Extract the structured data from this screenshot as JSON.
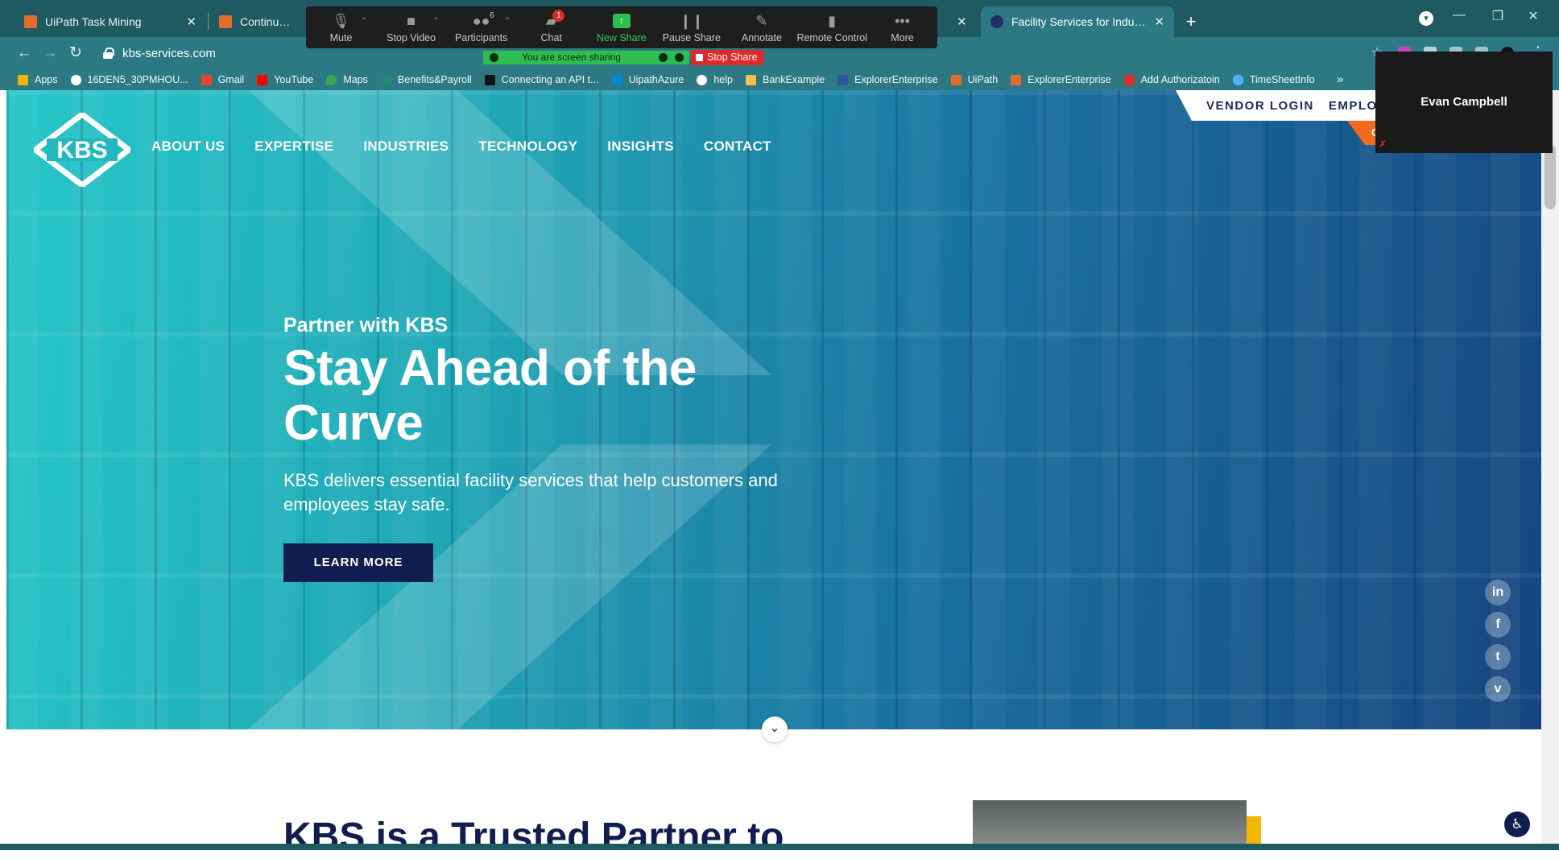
{
  "browser": {
    "tabs": [
      {
        "title": "UiPath Task Mining"
      },
      {
        "title": "Continue with Ui"
      },
      {
        "title": "Facility Services for Industry Lead"
      }
    ],
    "url": "kbs-services.com",
    "bookmarks": [
      {
        "label": "Apps",
        "icon": "apps-grid-icon",
        "color": "#f2b705"
      },
      {
        "label": "16DEN5_30PMHOU...",
        "icon": "globe-icon",
        "color": "#ffffff"
      },
      {
        "label": "Gmail",
        "icon": "gmail-icon",
        "color": "#ea4335"
      },
      {
        "label": "YouTube",
        "icon": "youtube-icon",
        "color": "#ff0000"
      },
      {
        "label": "Maps",
        "icon": "maps-pin-icon",
        "color": "#34a853"
      },
      {
        "label": "Benefits&Payroll",
        "icon": "payroll-icon",
        "color": "#1c8a6e"
      },
      {
        "label": "Connecting an API t...",
        "icon": "medium-icon",
        "color": "#111111"
      },
      {
        "label": "UipathAzure",
        "icon": "azure-icon",
        "color": "#0089d6"
      },
      {
        "label": "help",
        "icon": "github-icon",
        "color": "#ffffff"
      },
      {
        "label": "BankExample",
        "icon": "bank-icon",
        "color": "#f2c14e"
      },
      {
        "label": "ExplorerEnterprise",
        "icon": "word-icon",
        "color": "#2b579a"
      },
      {
        "label": "UiPath",
        "icon": "uipath-icon",
        "color": "#e26d2d"
      },
      {
        "label": "ExplorerEnterprise",
        "icon": "uipath-icon",
        "color": "#e26d2d"
      },
      {
        "label": "Add Authorizatoin",
        "icon": "puzzle-icon",
        "color": "#d93025"
      },
      {
        "label": "TimeSheetInfo",
        "icon": "cloud-icon",
        "color": "#4fb3f6"
      }
    ],
    "more_bookmarks": "»"
  },
  "zoom": {
    "buttons": [
      {
        "label": "Mute",
        "icon": "microphone-icon"
      },
      {
        "label": "Stop Video",
        "icon": "video-camera-icon"
      },
      {
        "label": "Participants",
        "icon": "participants-icon",
        "count": "6"
      },
      {
        "label": "Chat",
        "icon": "chat-bubble-icon",
        "badge": "1"
      },
      {
        "label": "New Share",
        "icon": "share-screen-icon"
      },
      {
        "label": "Pause Share",
        "icon": "pause-icon"
      },
      {
        "label": "Annotate",
        "icon": "pencil-icon"
      },
      {
        "label": "Remote Control",
        "icon": "mouse-icon"
      },
      {
        "label": "More",
        "icon": "ellipsis-icon"
      }
    ],
    "sharing_banner": "You are screen sharing",
    "stop_share": "Stop Share",
    "participant_name": "Evan Campbell"
  },
  "site": {
    "logo_text": "KBS",
    "utility_links": [
      "VENDOR LOGIN",
      "EMPLOYE"
    ],
    "orange_tab": "C",
    "nav": [
      "ABOUT US",
      "EXPERTISE",
      "INDUSTRIES",
      "TECHNOLOGY",
      "INSIGHTS",
      "CONTACT"
    ],
    "hero": {
      "kicker": "Partner with KBS",
      "headline": "Stay Ahead of the Curve",
      "subcopy": "KBS delivers essential facility services that help customers and employees stay safe.",
      "cta": "LEARN MORE"
    },
    "social": [
      {
        "name": "linkedin",
        "glyph": "in"
      },
      {
        "name": "facebook",
        "glyph": "f"
      },
      {
        "name": "twitter",
        "glyph": "t"
      },
      {
        "name": "vimeo",
        "glyph": "v"
      }
    ],
    "section_title": "KBS is a Trusted Partner to"
  },
  "colors": {
    "browser_tabstrip": "#1f5a61",
    "browser_toolbar": "#2d7983",
    "brand_navy": "#101d4f",
    "accent_orange": "#f26b21",
    "zoom_green": "#2dbe4f",
    "zoom_red": "#e02828"
  }
}
